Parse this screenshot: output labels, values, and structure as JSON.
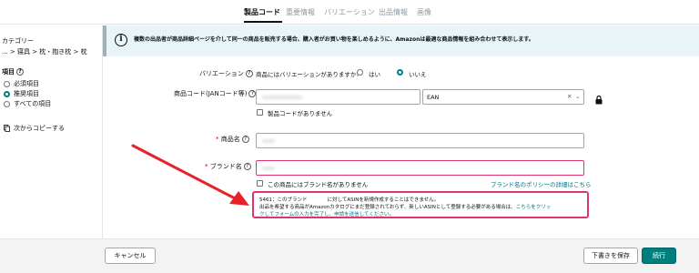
{
  "tabs": [
    {
      "label": "製品コード"
    },
    {
      "label": "重要情報"
    },
    {
      "label": "バリエーション"
    },
    {
      "label": "出品情報"
    },
    {
      "label": "画像"
    }
  ],
  "sidebar": {
    "category_heading": "カテゴリー",
    "category_path": "... > 寝具 > 枕・抱き枕 > 枕",
    "items_heading": "項目",
    "options": [
      {
        "label": "必須項目",
        "selected": false
      },
      {
        "label": "推奨項目",
        "selected": true
      },
      {
        "label": "すべての項目",
        "selected": false
      }
    ],
    "copy_label": "次からコピーする"
  },
  "info": {
    "text": "複数の出品者が商品詳細ページを介して同一の商品を販売する場合、購入者がお買い物を楽しめるように、Amazonは最適な商品情報を組み合わせて表示します。"
  },
  "form": {
    "variation": {
      "label": "バリエーション",
      "question": "商品にはバリエーションがありますか?",
      "yes": "はい",
      "no": "いいえ",
      "selected": "いいえ"
    },
    "product_code": {
      "label": "商品コード(JANコード等)",
      "type_value": "EAN",
      "no_code_label": "製品コードがありません"
    },
    "product_name": {
      "label": "商品名"
    },
    "brand": {
      "label": "ブランド名",
      "no_brand_label": "この商品にはブランド名がありません",
      "policy_link": "ブランド名のポリシーの詳細はこちら"
    },
    "error": {
      "line1": "5461：このブランド　　　　に対してASINを新規作成することはできません。",
      "line2_a": "出品を希望する商品がAmazonカタログにまだ登録されておらず、新しいASINとして登録する必要がある場合は、",
      "line2_link": "こちらをクリッ",
      "line3_a": "クしてフォームの入力を完了し、申請を送信してください",
      "line3_b": "。"
    }
  },
  "footer": {
    "cancel": "キャンセル",
    "save_draft": "下書きを保存",
    "submit": "続行"
  },
  "colors": {
    "accent": "#017e7e",
    "error": "#e0346e",
    "arrow": "#e8202a",
    "link": "#007185",
    "info_bg": "#e8f4f7"
  }
}
